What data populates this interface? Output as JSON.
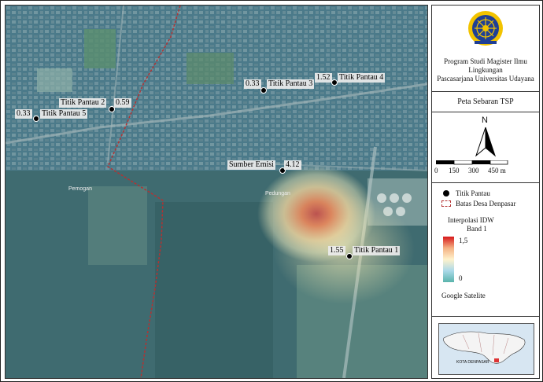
{
  "legend": {
    "institution_line1": "Program Studi Magister Ilmu",
    "institution_line2": "Lingkungan",
    "institution_line3": "Pascasarjana Universitas Udayana",
    "map_title": "Peta Sebaran TSP",
    "north": "N",
    "scale_ticks": [
      "0",
      "150",
      "300",
      "450 m"
    ],
    "point_label": "Titik Pantau",
    "boundary_label": "Batas Desa Denpasar",
    "idw_title": "Interpolasi IDW",
    "idw_band": "Band 1",
    "idw_max": "1,5",
    "idw_min": "0",
    "basemap": "Google Satelite",
    "inset_caption": "KOTA DENPASAR",
    "ramp_colors": [
      "#d7191c",
      "#f4b183",
      "#fff2cc",
      "#abd9e9",
      "#5ab4ac"
    ]
  },
  "map": {
    "points": [
      {
        "name": "Titik Pantau 5",
        "value": "0.33"
      },
      {
        "name": "Titik Pantau 2",
        "value": "0.59"
      },
      {
        "name": "Titik Pantau 3",
        "value": "0.33"
      },
      {
        "name": "Titik Pantau 4",
        "value": "1.52"
      },
      {
        "name": "Sumber Emisi",
        "value": "4.12"
      },
      {
        "name": "Titik Pantau 1",
        "value": "1.55"
      }
    ],
    "places": [
      "Pemogan",
      "Pedungan"
    ]
  }
}
